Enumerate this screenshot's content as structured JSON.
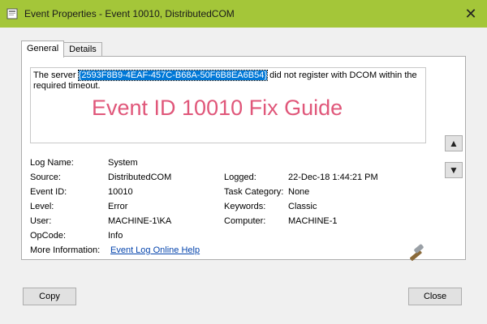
{
  "window": {
    "title": "Event Properties - Event 10010, DistributedCOM",
    "close_glyph": "✕"
  },
  "tabs": [
    {
      "label": "General"
    },
    {
      "label": "Details"
    }
  ],
  "description": {
    "prefix": "The server ",
    "selected": "{2593F8B9-4EAF-457C-B68A-50F6B8EA6B54}",
    "suffix_line1": " did not register with DCOM within the",
    "line2": "required timeout."
  },
  "overlay": {
    "text": "Event ID 10010 Fix Guide",
    "color": "#e0577a"
  },
  "properties": {
    "log_name_label": "Log Name:",
    "log_name_value": "System",
    "source_label": "Source:",
    "source_value": "DistributedCOM",
    "logged_label": "Logged:",
    "logged_value": "22-Dec-18 1:44:21 PM",
    "event_id_label": "Event ID:",
    "event_id_value": "10010",
    "task_category_label": "Task Category:",
    "task_category_value": "None",
    "level_label": "Level:",
    "level_value": "Error",
    "keywords_label": "Keywords:",
    "keywords_value": "Classic",
    "user_label": "User:",
    "user_value": "MACHINE-1\\KA",
    "computer_label": "Computer:",
    "computer_value": "MACHINE-1",
    "opcode_label": "OpCode:",
    "opcode_value": "Info",
    "more_info_label": "More Information:",
    "more_info_link": "Event Log Online Help"
  },
  "nav": {
    "up_glyph": "▲",
    "down_glyph": "▼"
  },
  "buttons": {
    "copy": "Copy",
    "close": "Close"
  },
  "colors": {
    "titlebar": "#a4c639",
    "selection": "#0078d7",
    "link": "#0645ad"
  }
}
